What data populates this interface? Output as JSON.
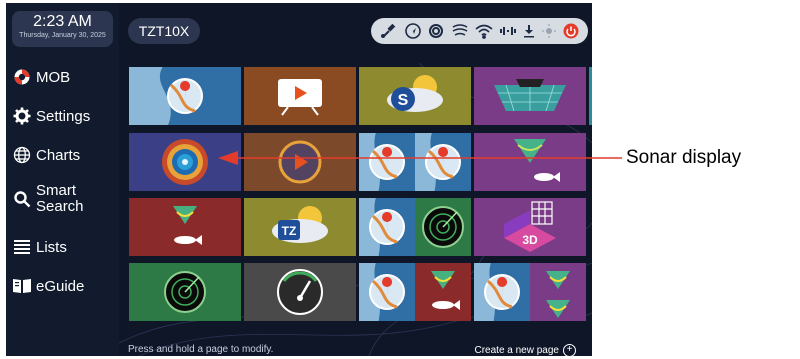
{
  "clock": {
    "time": "2:23 AM",
    "date": "Thursday, January 30, 2025"
  },
  "sidebar": {
    "items": [
      {
        "label": "MOB",
        "icon": "lifebuoy-icon"
      },
      {
        "label": "Settings",
        "icon": "gear-icon"
      },
      {
        "label": "Charts",
        "icon": "globe-icon"
      },
      {
        "label": "Smart\nSearch",
        "icon": "search-icon"
      },
      {
        "label": "Lists",
        "icon": "list-icon"
      },
      {
        "label": "eGuide",
        "icon": "book-icon"
      }
    ]
  },
  "header": {
    "page_name": "TZT10X"
  },
  "status_icons": [
    "satellite-icon",
    "navigation-icon",
    "radar-icon",
    "sonar-icon",
    "wifi-icon",
    "signal-icon",
    "download-icon",
    "brightness-icon",
    "power-icon"
  ],
  "tiles": [
    {
      "name": "chart-tile",
      "bg": "#2f6fa5",
      "kind": "chart"
    },
    {
      "name": "video-tile",
      "bg": "#8a4a22",
      "kind": "video"
    },
    {
      "name": "weather-tile",
      "bg": "#8e8a2f",
      "kind": "weather"
    },
    {
      "name": "sonar-3d-tile",
      "bg": "#7a3c86",
      "kind": "sonar3d"
    },
    {
      "name": "sonar-display-tile",
      "bg": "#3b3f86",
      "kind": "sonar"
    },
    {
      "name": "video-sonar-tile",
      "bg": "#7c4a2a",
      "kind": "videosonar"
    },
    {
      "name": "chart-chart-tile",
      "bg": "#2f6fa5",
      "kind": "chartchart"
    },
    {
      "name": "fish-finder-wide-tile",
      "bg": "#7a3c86",
      "kind": "fishwide"
    },
    {
      "name": "fish-finder-tile",
      "bg": "#8b2a2a",
      "kind": "fish"
    },
    {
      "name": "timezero-tile",
      "bg": "#8e8a2f",
      "kind": "tz"
    },
    {
      "name": "chart-radar-tile",
      "bg": "#2f6fa5",
      "kind": "chartradar"
    },
    {
      "name": "3d-tile",
      "bg": "#7a3c86",
      "kind": "threed"
    },
    {
      "name": "radar-tile",
      "bg": "#2e7a46",
      "kind": "radar"
    },
    {
      "name": "instrument-tile",
      "bg": "#4a4a4a",
      "kind": "gauge"
    },
    {
      "name": "chart-fish-tile",
      "bg": "#2f6fa5",
      "kind": "chartfish"
    },
    {
      "name": "chart-multi-tile",
      "bg": "#2f6fa5",
      "kind": "chartmulti"
    }
  ],
  "footer": {
    "hint": "Press and hold a page to modify.",
    "create_label": "Create a new page",
    "plus": "+"
  },
  "callout": {
    "label": "Sonar display"
  },
  "colors": {
    "accent": "#e43b2b",
    "sidebar": "#121b2e",
    "background": "#0f1628"
  }
}
